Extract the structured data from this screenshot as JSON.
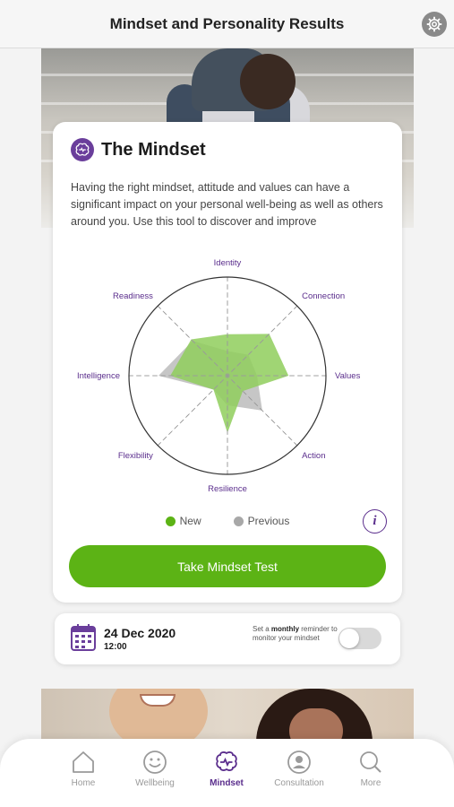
{
  "header": {
    "title": "Mindset and Personality Results"
  },
  "mindset_card": {
    "title": "The Mindset",
    "description": "Having the right mindset, attitude and values can have a significant impact on your personal well-being as well as others around you. Use this tool to discover and improve",
    "radar": {
      "axes": [
        "Identity",
        "Connection",
        "Values",
        "Action",
        "Resilience",
        "Flexibility",
        "Intelligence",
        "Readiness"
      ],
      "series": [
        {
          "name": "New",
          "values": [
            0.42,
            0.6,
            0.62,
            0.22,
            0.58,
            0.2,
            0.58,
            0.52
          ]
        },
        {
          "name": "Previous",
          "values": [
            0.25,
            0.3,
            0.3,
            0.5,
            0.3,
            0.2,
            0.7,
            0.5
          ]
        }
      ]
    },
    "legend": {
      "new": "New",
      "previous": "Previous"
    },
    "info_label": "i",
    "button_label": "Take Mindset Test"
  },
  "reminder": {
    "date": "24 Dec 2020",
    "time": "12:00",
    "text_prefix": "Set a",
    "text_bold": "monthly",
    "text_suffix": "reminder to monitor your mindset",
    "toggle_on": false
  },
  "nav": {
    "items": [
      {
        "label": "Home",
        "icon": "home-icon",
        "active": false
      },
      {
        "label": "Wellbeing",
        "icon": "smiley-icon",
        "active": false
      },
      {
        "label": "Mindset",
        "icon": "brain-icon",
        "active": true
      },
      {
        "label": "Consultation",
        "icon": "person-icon",
        "active": false
      },
      {
        "label": "More",
        "icon": "search-icon",
        "active": false
      }
    ]
  },
  "colors": {
    "accent": "#5a2d8c",
    "green": "#5cb315",
    "new_series": "#8fce5c",
    "previous_series": "#b3b3b3"
  }
}
